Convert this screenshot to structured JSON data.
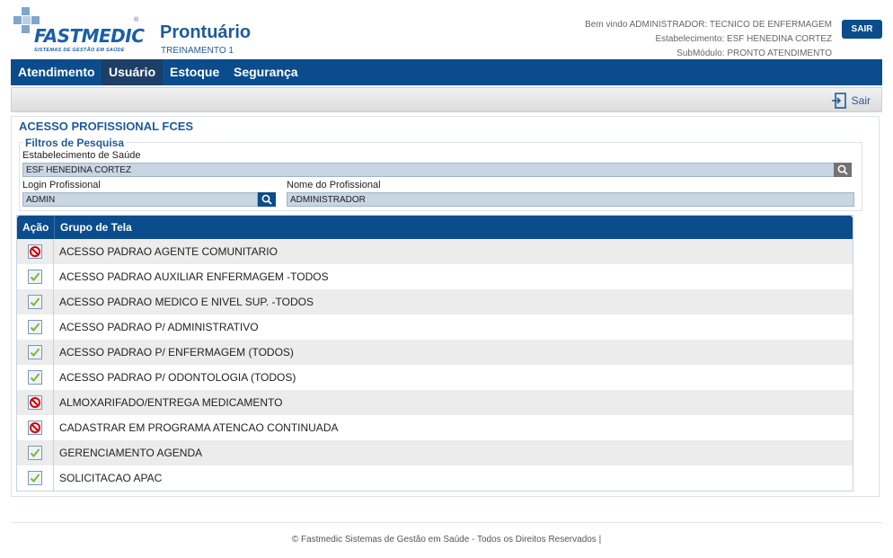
{
  "brand": {
    "name": "FASTMEDIC",
    "registered": "®",
    "tagline": "SISTEMAS DE GESTÃO EM SAÚDE",
    "primary_color": "#0a4c8c"
  },
  "header": {
    "title": "Prontuário",
    "subtitle": "TREINAMENTO 1",
    "welcome": "Bem vindo ADMINISTRADOR: TECNICO DE ENFERMAGEM",
    "establishment": "Estabelecimento: ESF HENEDINA CORTEZ",
    "submodule": "SubMódulo: PRONTO ATENDIMENTO",
    "logout_label": "SAIR"
  },
  "nav": {
    "items": [
      {
        "label": "Atendimento"
      },
      {
        "label": "Usuário",
        "active": true
      },
      {
        "label": "Estoque"
      },
      {
        "label": "Segurança"
      }
    ]
  },
  "toolbar": {
    "exit_label": "Sair",
    "exit_icon": "exit-door-icon"
  },
  "main": {
    "title": "ACESSO PROFISSIONAL FCES",
    "filters": {
      "title": "Filtros de Pesquisa",
      "establishment_label": "Estabelecimento de Saúde",
      "establishment_value": "ESF HENEDINA CORTEZ",
      "login_label": "Login Profissional",
      "login_value": "ADMIN",
      "name_label": "Nome do Profissional",
      "name_value": "ADMINISTRADOR"
    },
    "table": {
      "columns": [
        "Ação",
        "Grupo de Tela"
      ],
      "rows": [
        {
          "status": "denied",
          "icon": "prohibited-icon",
          "label": "ACESSO PADRAO AGENTE COMUNITARIO"
        },
        {
          "status": "allowed",
          "icon": "checkmark-icon",
          "label": "ACESSO PADRAO AUXILIAR ENFERMAGEM -TODOS"
        },
        {
          "status": "allowed",
          "icon": "checkmark-icon",
          "label": "ACESSO PADRAO MEDICO E NIVEL SUP. -TODOS"
        },
        {
          "status": "allowed",
          "icon": "checkmark-icon",
          "label": "ACESSO PADRAO P/ ADMINISTRATIVO"
        },
        {
          "status": "allowed",
          "icon": "checkmark-icon",
          "label": "ACESSO PADRAO P/ ENFERMAGEM (TODOS)"
        },
        {
          "status": "allowed",
          "icon": "checkmark-icon",
          "label": "ACESSO PADRAO P/ ODONTOLOGIA (TODOS)"
        },
        {
          "status": "denied",
          "icon": "prohibited-icon",
          "label": "ALMOXARIFADO/ENTREGA MEDICAMENTO"
        },
        {
          "status": "denied",
          "icon": "prohibited-icon",
          "label": "CADASTRAR EM PROGRAMA ATENCAO CONTINUADA"
        },
        {
          "status": "allowed",
          "icon": "checkmark-icon",
          "label": "GERENCIAMENTO AGENDA"
        },
        {
          "status": "allowed",
          "icon": "checkmark-icon",
          "label": "SOLICITACAO APAC"
        }
      ]
    }
  },
  "footer": {
    "text": "© Fastmedic Sistemas de Gestão em Saúde - Todos os Direitos Reservados |"
  }
}
